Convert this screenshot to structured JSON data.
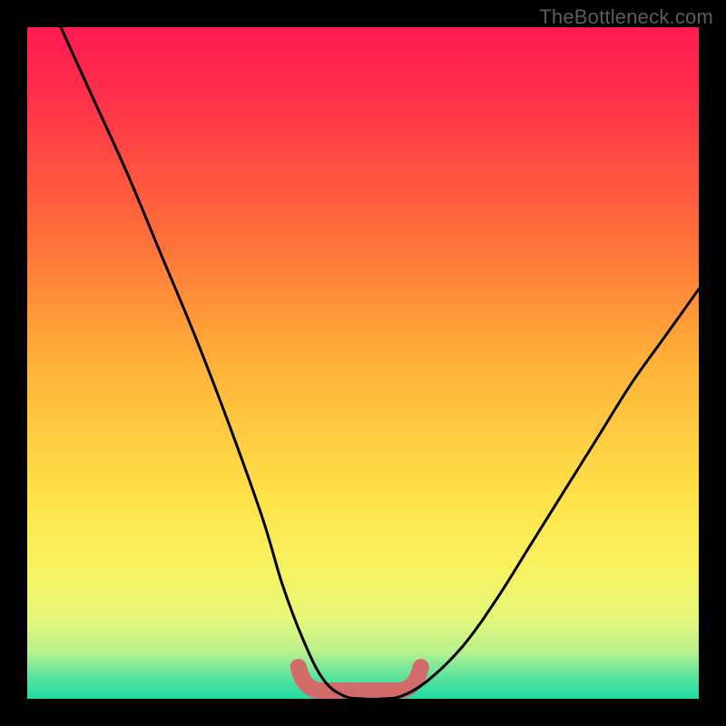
{
  "attribution": "TheBottleneck.com",
  "colors": {
    "frame": "#000000",
    "curve": "#000000",
    "dip_marker": "#d36a6a",
    "gradient_stops": [
      {
        "offset": 0.0,
        "color": "#ff1a52"
      },
      {
        "offset": 0.1,
        "color": "#ff2f4a"
      },
      {
        "offset": 0.3,
        "color": "#ff6a3a"
      },
      {
        "offset": 0.5,
        "color": "#ffb238"
      },
      {
        "offset": 0.7,
        "color": "#ffe24a"
      },
      {
        "offset": 0.8,
        "color": "#f8f25e"
      },
      {
        "offset": 0.88,
        "color": "#e6f77a"
      },
      {
        "offset": 0.93,
        "color": "#b8f18c"
      },
      {
        "offset": 0.965,
        "color": "#5fe49d"
      },
      {
        "offset": 1.0,
        "color": "#21dba4"
      }
    ]
  },
  "chart_data": {
    "type": "line",
    "title": "",
    "xlabel": "",
    "ylabel": "",
    "xlim": [
      0,
      100
    ],
    "ylim": [
      0,
      100
    ],
    "notes": "Bottleneck-percentage style curve. Y is roughly 'bottleneck %' (high = red = bad, low = green = good). X is an unlabeled parameter sweep. Values are estimated from pixel positions; no numeric axis labels are present in the source image.",
    "series": [
      {
        "name": "bottleneck-curve",
        "x": [
          5,
          10,
          15,
          20,
          25,
          30,
          35,
          38,
          41,
          44,
          47,
          50,
          53,
          56,
          60,
          65,
          70,
          75,
          80,
          85,
          90,
          95,
          100
        ],
        "y": [
          100,
          89,
          78,
          66,
          54,
          41,
          27,
          17,
          9,
          3,
          0.5,
          0,
          0,
          0.5,
          3,
          8,
          15,
          23,
          31,
          39,
          47,
          54,
          61
        ]
      }
    ],
    "dip_marker": {
      "x_start": 42,
      "x_end": 57,
      "y": 0,
      "description": "Flat green zone at the curve minimum, highlighted with a thick rounded salmon stroke."
    }
  }
}
